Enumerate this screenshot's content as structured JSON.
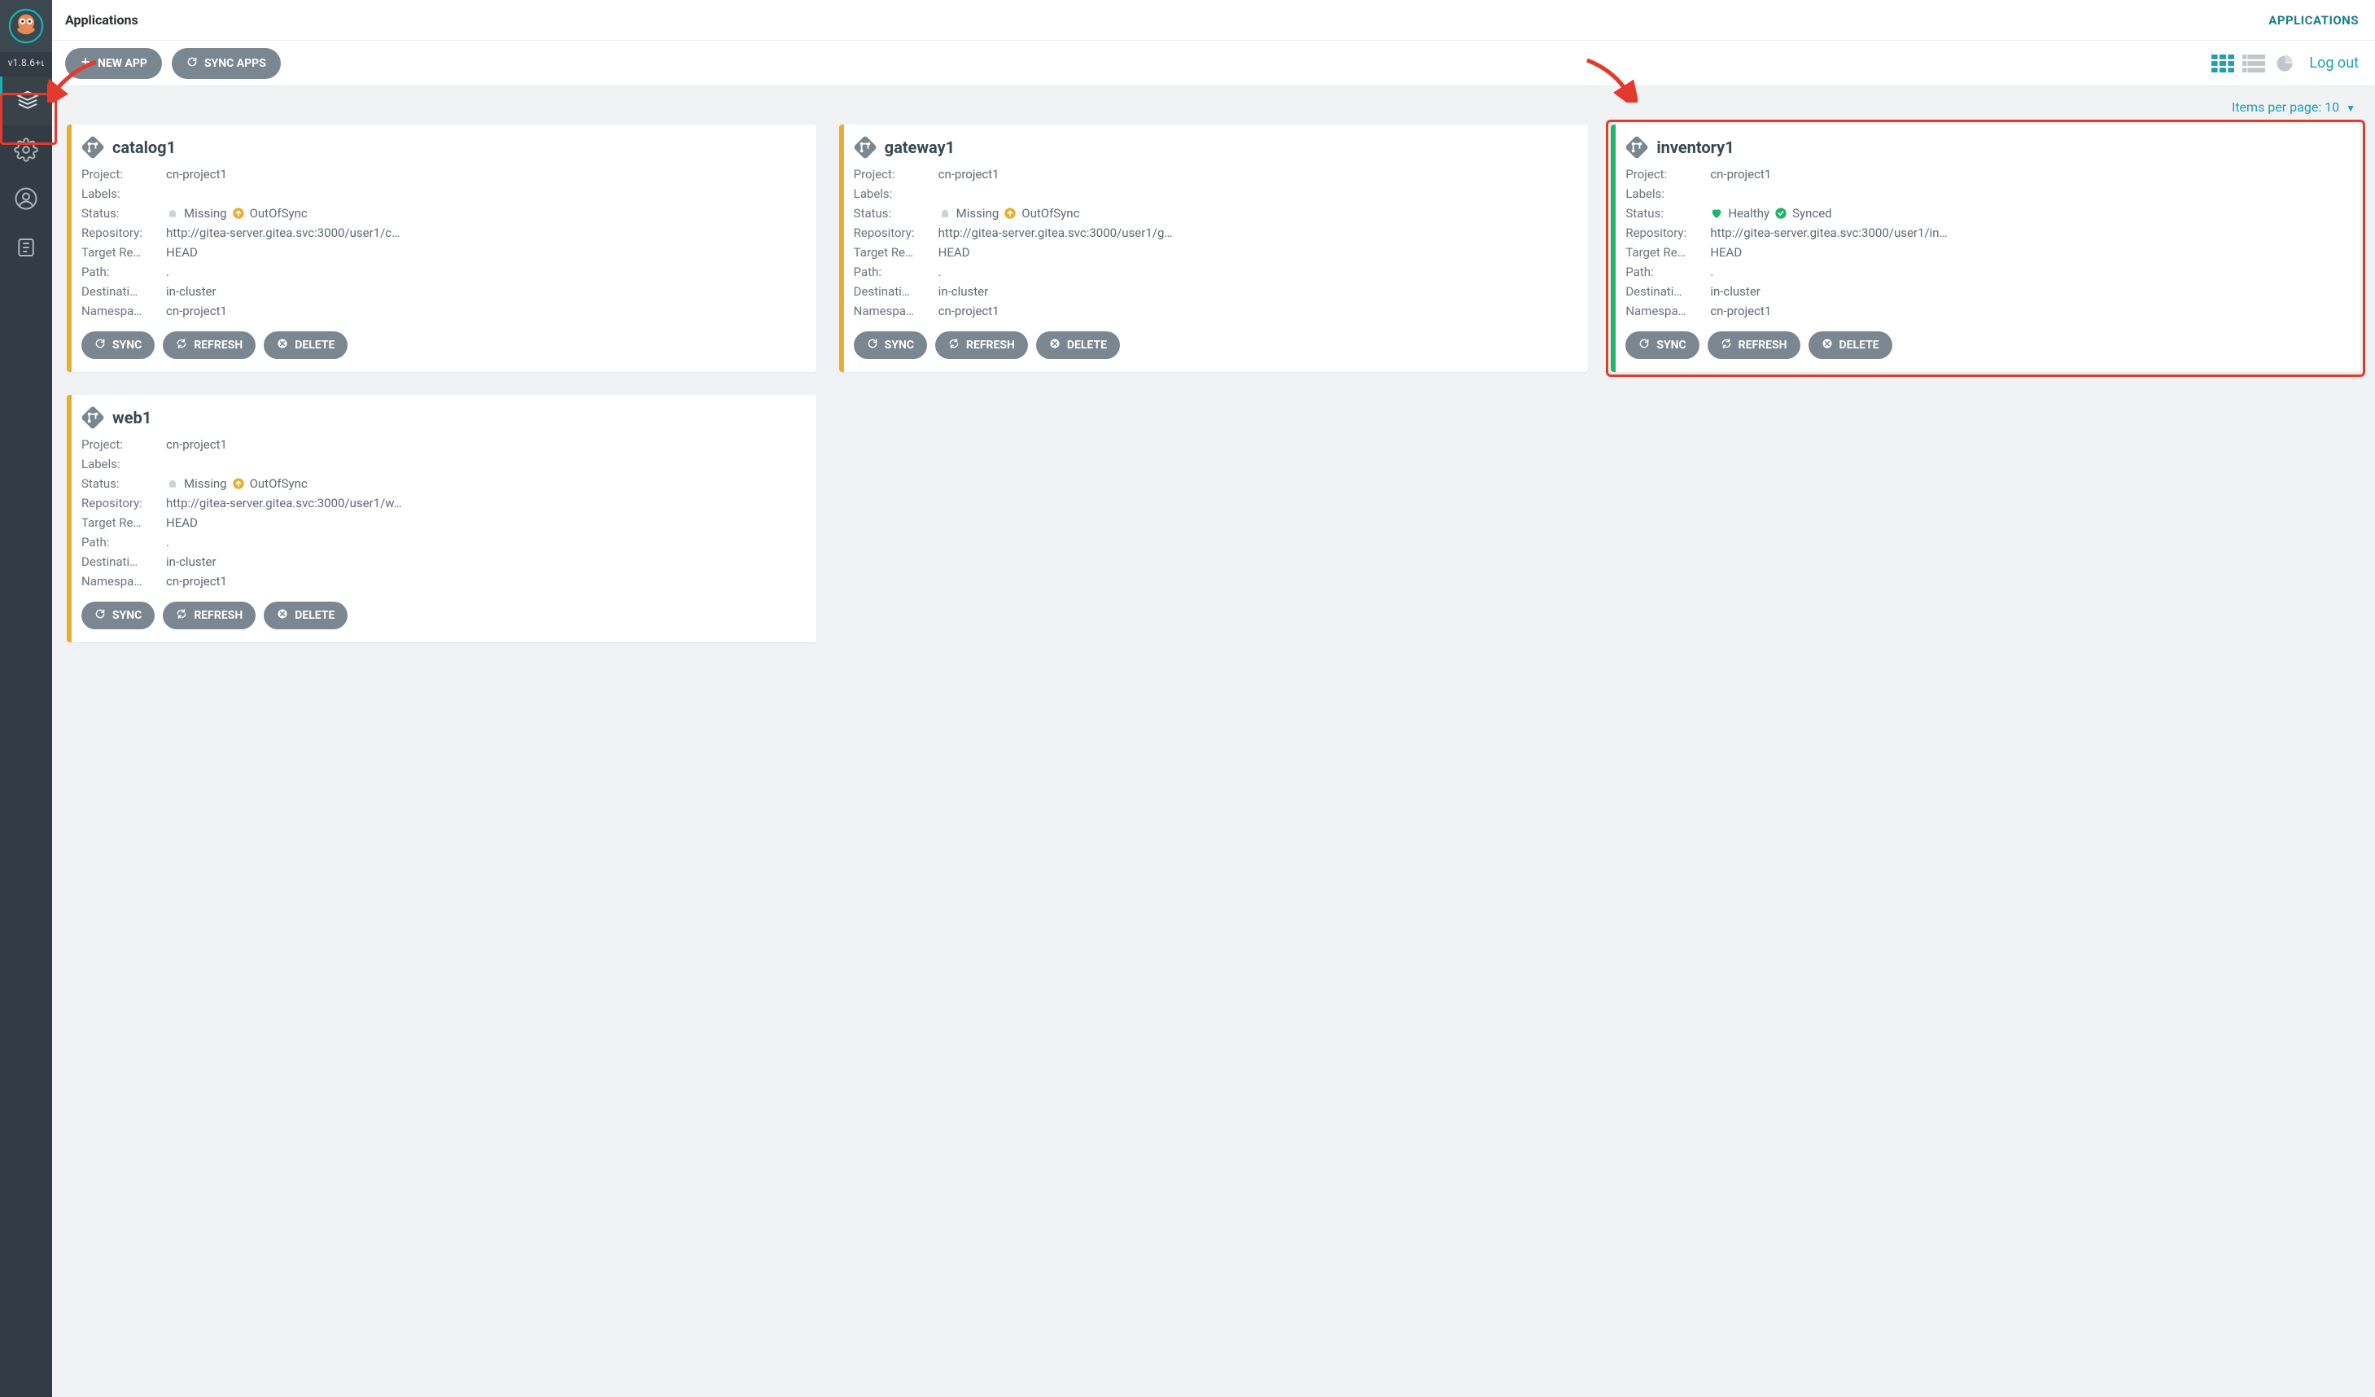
{
  "sidebar": {
    "version": "v1.8.6+ι"
  },
  "header": {
    "title": "Applications",
    "right": "APPLICATIONS"
  },
  "toolbar": {
    "new_app": "NEW APP",
    "sync_apps": "SYNC APPS",
    "logout": "Log out"
  },
  "pager": {
    "label": "Items per page:",
    "value": "10"
  },
  "field_labels": {
    "project": "Project:",
    "labels": "Labels:",
    "status": "Status:",
    "repository": "Repository:",
    "target": "Target Re…",
    "path": "Path:",
    "destination": "Destinati…",
    "namespace": "Namespa…"
  },
  "status_words": {
    "missing": "Missing",
    "outofsync": "OutOfSync",
    "healthy": "Healthy",
    "synced": "Synced"
  },
  "card_buttons": {
    "sync": "SYNC",
    "refresh": "REFRESH",
    "delete": "DELETE"
  },
  "apps": [
    {
      "name": "catalog1",
      "project": "cn-project1",
      "labels": "",
      "status_kind": "missing_outofsync",
      "repository": "http://gitea-server.gitea.svc:3000/user1/c…",
      "target": "HEAD",
      "path": ".",
      "destination": "in-cluster",
      "namespace": "cn-project1"
    },
    {
      "name": "gateway1",
      "project": "cn-project1",
      "labels": "",
      "status_kind": "missing_outofsync",
      "repository": "http://gitea-server.gitea.svc:3000/user1/g…",
      "target": "HEAD",
      "path": ".",
      "destination": "in-cluster",
      "namespace": "cn-project1"
    },
    {
      "name": "inventory1",
      "project": "cn-project1",
      "labels": "",
      "status_kind": "healthy_synced",
      "repository": "http://gitea-server.gitea.svc:3000/user1/in…",
      "target": "HEAD",
      "path": ".",
      "destination": "in-cluster",
      "namespace": "cn-project1"
    },
    {
      "name": "web1",
      "project": "cn-project1",
      "labels": "",
      "status_kind": "missing_outofsync",
      "repository": "http://gitea-server.gitea.svc:3000/user1/w…",
      "target": "HEAD",
      "path": ".",
      "destination": "in-cluster",
      "namespace": "cn-project1"
    }
  ]
}
